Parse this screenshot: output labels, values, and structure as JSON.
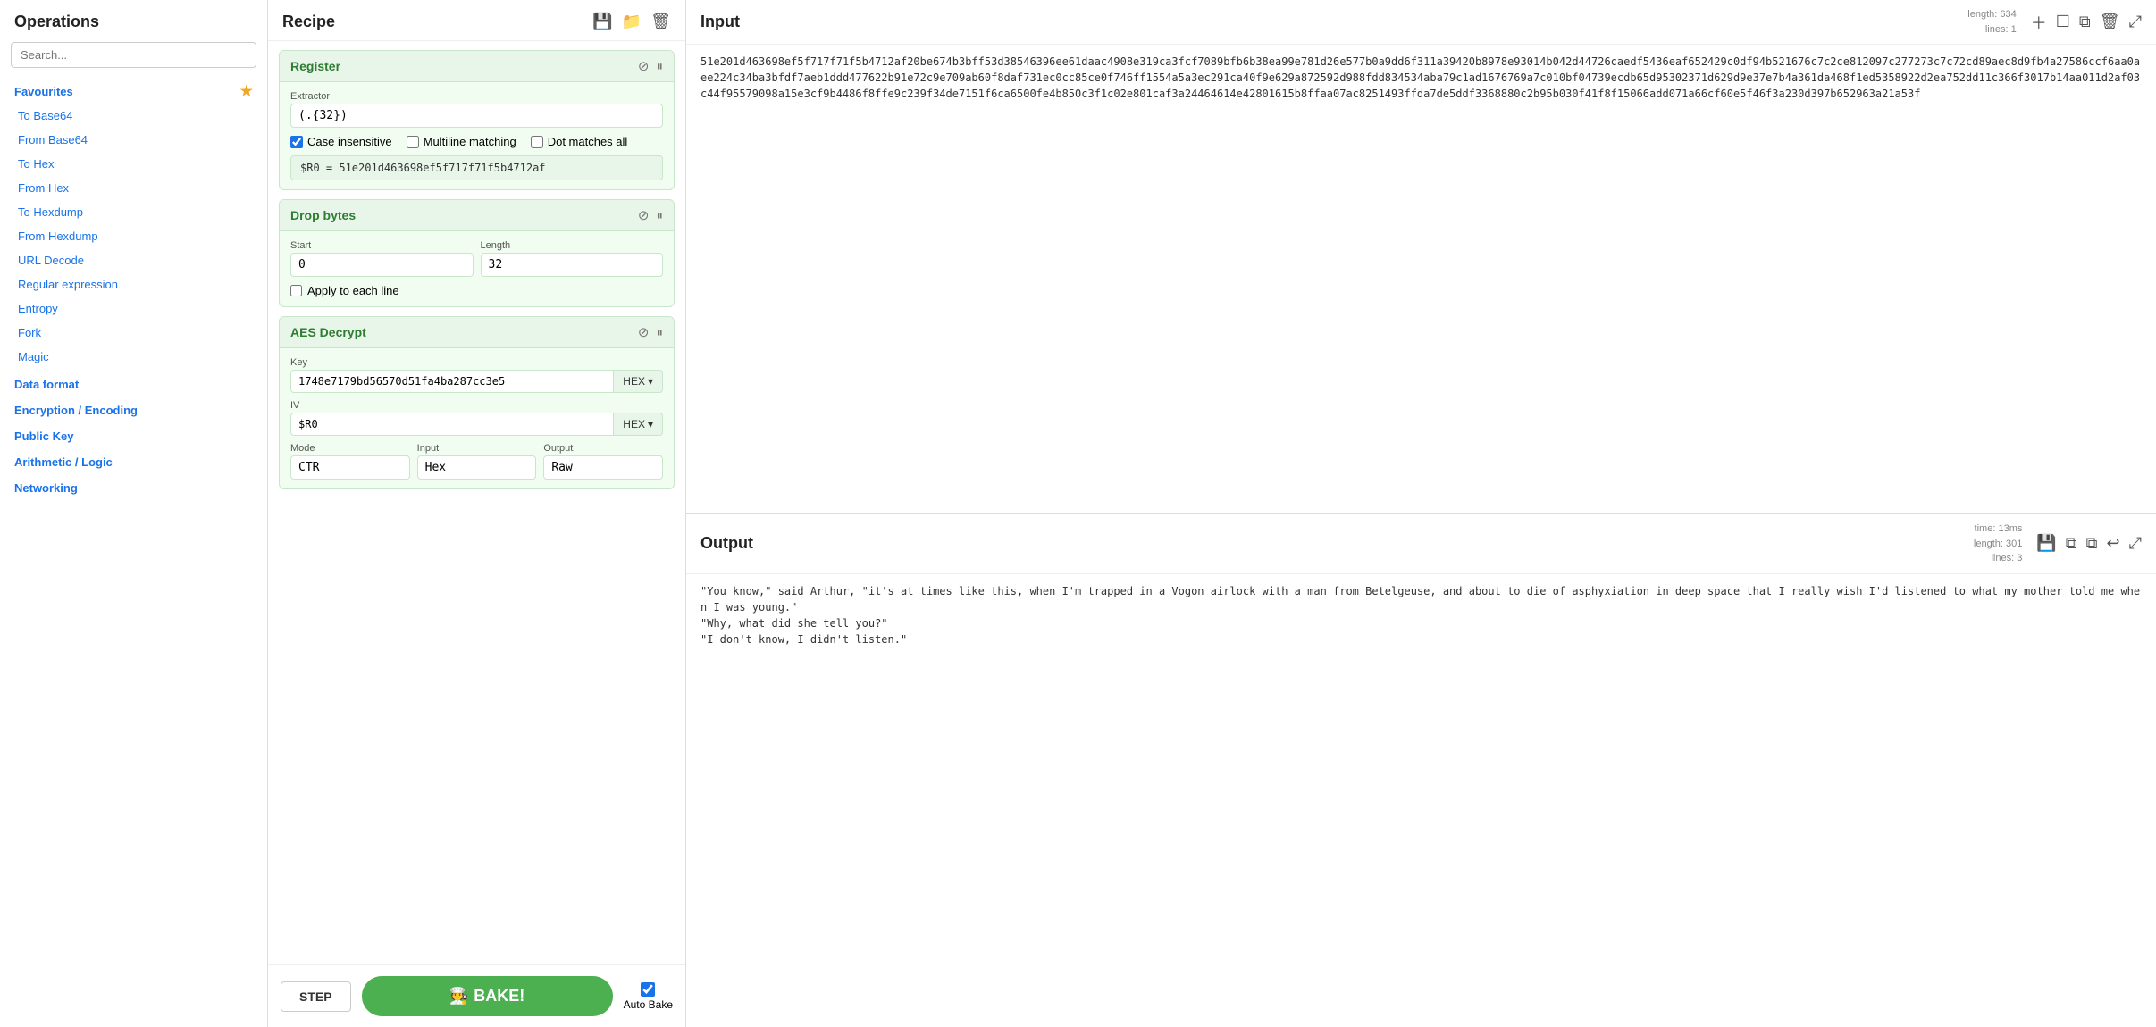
{
  "sidebar": {
    "title": "Operations",
    "search_placeholder": "Search...",
    "favourites_label": "Favourites",
    "nav_items": [
      {
        "label": "To Base64",
        "id": "to-base64"
      },
      {
        "label": "From Base64",
        "id": "from-base64"
      },
      {
        "label": "To Hex",
        "id": "to-hex"
      },
      {
        "label": "From Hex",
        "id": "from-hex"
      },
      {
        "label": "To Hexdump",
        "id": "to-hexdump"
      },
      {
        "label": "From Hexdump",
        "id": "from-hexdump"
      },
      {
        "label": "URL Decode",
        "id": "url-decode"
      },
      {
        "label": "Regular expression",
        "id": "regex"
      },
      {
        "label": "Entropy",
        "id": "entropy"
      },
      {
        "label": "Fork",
        "id": "fork"
      },
      {
        "label": "Magic",
        "id": "magic"
      }
    ],
    "categories": [
      {
        "label": "Data format"
      },
      {
        "label": "Encryption / Encoding"
      },
      {
        "label": "Public Key"
      },
      {
        "label": "Arithmetic / Logic"
      },
      {
        "label": "Networking"
      }
    ]
  },
  "recipe": {
    "title": "Recipe",
    "header_icons": [
      "💾",
      "📁",
      "🗑"
    ],
    "operations": [
      {
        "id": "register",
        "title": "Register",
        "extractor_label": "Extractor",
        "extractor_value": "(.{32})",
        "case_insensitive": true,
        "multiline_matching": false,
        "dot_matches_all": false,
        "case_insensitive_label": "Case insensitive",
        "multiline_label": "Multiline matching",
        "dot_label": "Dot matches all",
        "result": "$R0 = 51e201d463698ef5f717f71f5b4712af"
      },
      {
        "id": "drop-bytes",
        "title": "Drop bytes",
        "start_label": "Start",
        "start_value": "0",
        "length_label": "Length",
        "length_value": "32",
        "apply_each_line": false,
        "apply_label": "Apply to each line"
      },
      {
        "id": "aes-decrypt",
        "title": "AES Decrypt",
        "key_label": "Key",
        "key_value": "1748e7179bd56570d51fa4ba287cc3e5",
        "key_type": "HEX",
        "iv_label": "IV",
        "iv_value": "$R0",
        "iv_type": "HEX",
        "mode_label": "Mode",
        "mode_value": "CTR",
        "input_label": "Input",
        "input_value": "Hex",
        "output_label": "Output",
        "output_value": "Raw"
      }
    ],
    "step_label": "STEP",
    "bake_label": "🧑‍🍳 BAKE!",
    "auto_bake_label": "Auto Bake",
    "auto_bake_checked": true
  },
  "input_panel": {
    "title": "Input",
    "length": "634",
    "lines": "1",
    "length_label": "length:",
    "lines_label": "lines:",
    "content": "51e201d463698ef5f717f71f5b4712af20be674b3bff53d38546396ee61daac4908e319ca3fcf7089bfb6b38ea99e781d26e577b0a9dd6f311a39420b8978e93014b042d44726caedf5436eaf652429c0df94b521676c7c2ce812097c277273c7c72cd89aec8d9fb4a27586ccf6aa0aee224c34ba3bfdf7aeb1ddd477622b91e72c9e709ab60f8daf731ec0cc85ce0f746ff1554a5a3ec291ca40f9e629a872592d988fdd834534aba79c1ad1676769a7c010bf04739ecdb65d95302371d629d9e37e7b4a361da468f1ed5358922d2ea752dd11c366f3017b14aa011d2af03c44f95579098a15e3cf9b4486f8ffe9c239f34de7151f6ca6500fe4b850c3f1c02e801caf3a24464614e42801615b8ffaa07ac8251493ffda7de5ddf3368880c2b95b030f41f8f15066add071a66cf60e5f46f3a230d397b652963a21a53f"
  },
  "output_panel": {
    "title": "Output",
    "time": "13ms",
    "length": "301",
    "lines": "3",
    "time_label": "time:",
    "length_label": "length:",
    "lines_label": "lines:",
    "content": "\"You know,\" said Arthur, \"it's at times like this, when I'm trapped in a Vogon airlock with a man from Betelgeuse, and about to die of asphyxiation in deep space that I really wish I'd listened to what my mother told me when I was young.\"\n\"Why, what did she tell you?\"\n\"I don't know, I didn't listen.\""
  }
}
